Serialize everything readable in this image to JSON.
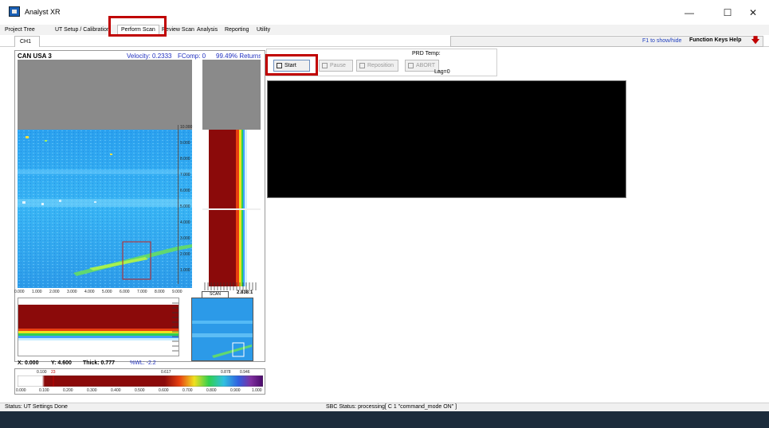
{
  "window": {
    "title": "Analyst XR",
    "minimize": "—",
    "maximize": "☐",
    "close": "✕"
  },
  "menu": {
    "tabs": [
      "Project Tree",
      "UT Setup / Calibration",
      "Perform Scan",
      "Review Scan",
      "Analysis",
      "Reporting",
      "Utility"
    ],
    "active_tab": "Perform Scan"
  },
  "channel_tab": "CH1",
  "hint": {
    "f1": "F1 to show/hide",
    "function_keys": "Function Keys Help"
  },
  "scan_panel": {
    "name": "CAN USA 3",
    "velocity": "Velocity: 0.2333",
    "fcomp": "FComp: 0",
    "returns": "99.49% Returns",
    "x_ticks": [
      "0.000",
      "1.000",
      "2.000",
      "3.000",
      "4.000",
      "5.000",
      "6.000",
      "7.000",
      "8.000",
      "9.000"
    ],
    "depth_ticks": [
      "10.000",
      "9.000",
      "8.000",
      "7.000",
      "6.000",
      "5.000",
      "4.000",
      "3.000",
      "2.000",
      "1.000"
    ],
    "scan_label": "SCAN",
    "ratio": "2.838:1"
  },
  "readout": {
    "x": "X: 0.000",
    "y": "Y: 4.600",
    "thick": "Thick: 0.777",
    "wl": "%WL: -2.2"
  },
  "colorbar": {
    "top_labels": [
      "0.100",
      "23",
      "0.617",
      "0.878",
      "0.946"
    ],
    "bottom_ticks": [
      "0.000",
      "0.100",
      "0.200",
      "0.300",
      "0.400",
      "0.500",
      "0.600",
      "0.700",
      "0.800",
      "0.900",
      "1.000"
    ]
  },
  "controls": {
    "start": "Start",
    "pause": "Pause",
    "reposition": "Reposition",
    "abort": "ABORT",
    "prd_temp": "PRD Temp:",
    "lag": "Lag=0"
  },
  "status": {
    "left": "Status: UT Settings Done",
    "sbc": "SBC Status: processing[ C 1 \"command_mode ON\" ]"
  }
}
